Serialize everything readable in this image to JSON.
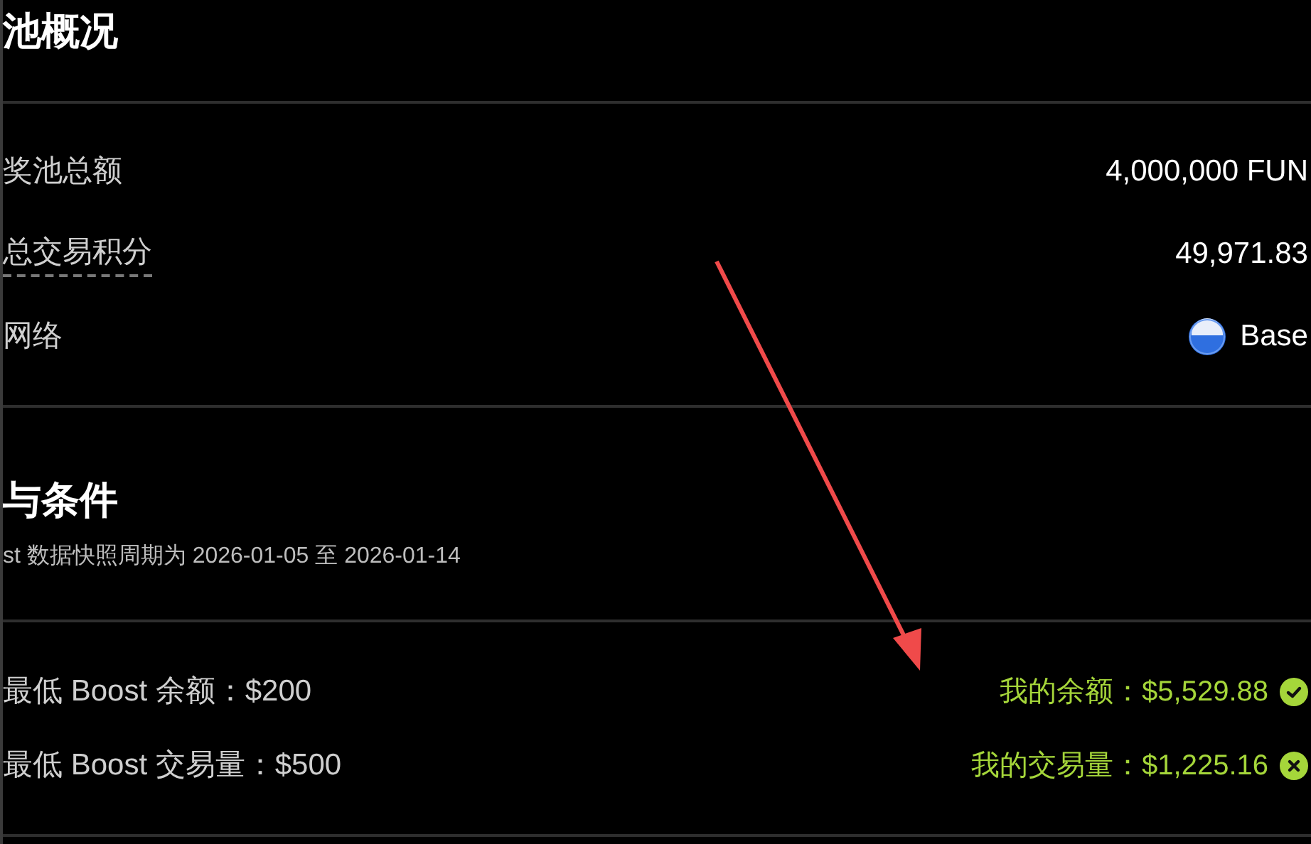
{
  "pool_overview": {
    "title": "池概况",
    "rows": [
      {
        "label": "奖池总额",
        "value": "4,000,000 FUN",
        "kind": "plain"
      },
      {
        "label": "总交易积分",
        "value": "49,971.83",
        "kind": "tooltip"
      },
      {
        "label": "网络",
        "value": "Base",
        "kind": "network"
      }
    ]
  },
  "conditions": {
    "title": "与条件",
    "subtitle": "st 数据快照周期为 2026-01-05 至 2026-01-14",
    "items": [
      {
        "requirement": "最低 Boost 余额：$200",
        "mine": "我的余额：$5,529.88",
        "met": true
      },
      {
        "requirement": "最低 Boost 交易量：$500",
        "mine": "我的交易量：$1,225.16",
        "met": false
      }
    ]
  },
  "annotation": {
    "kind": "arrow"
  }
}
